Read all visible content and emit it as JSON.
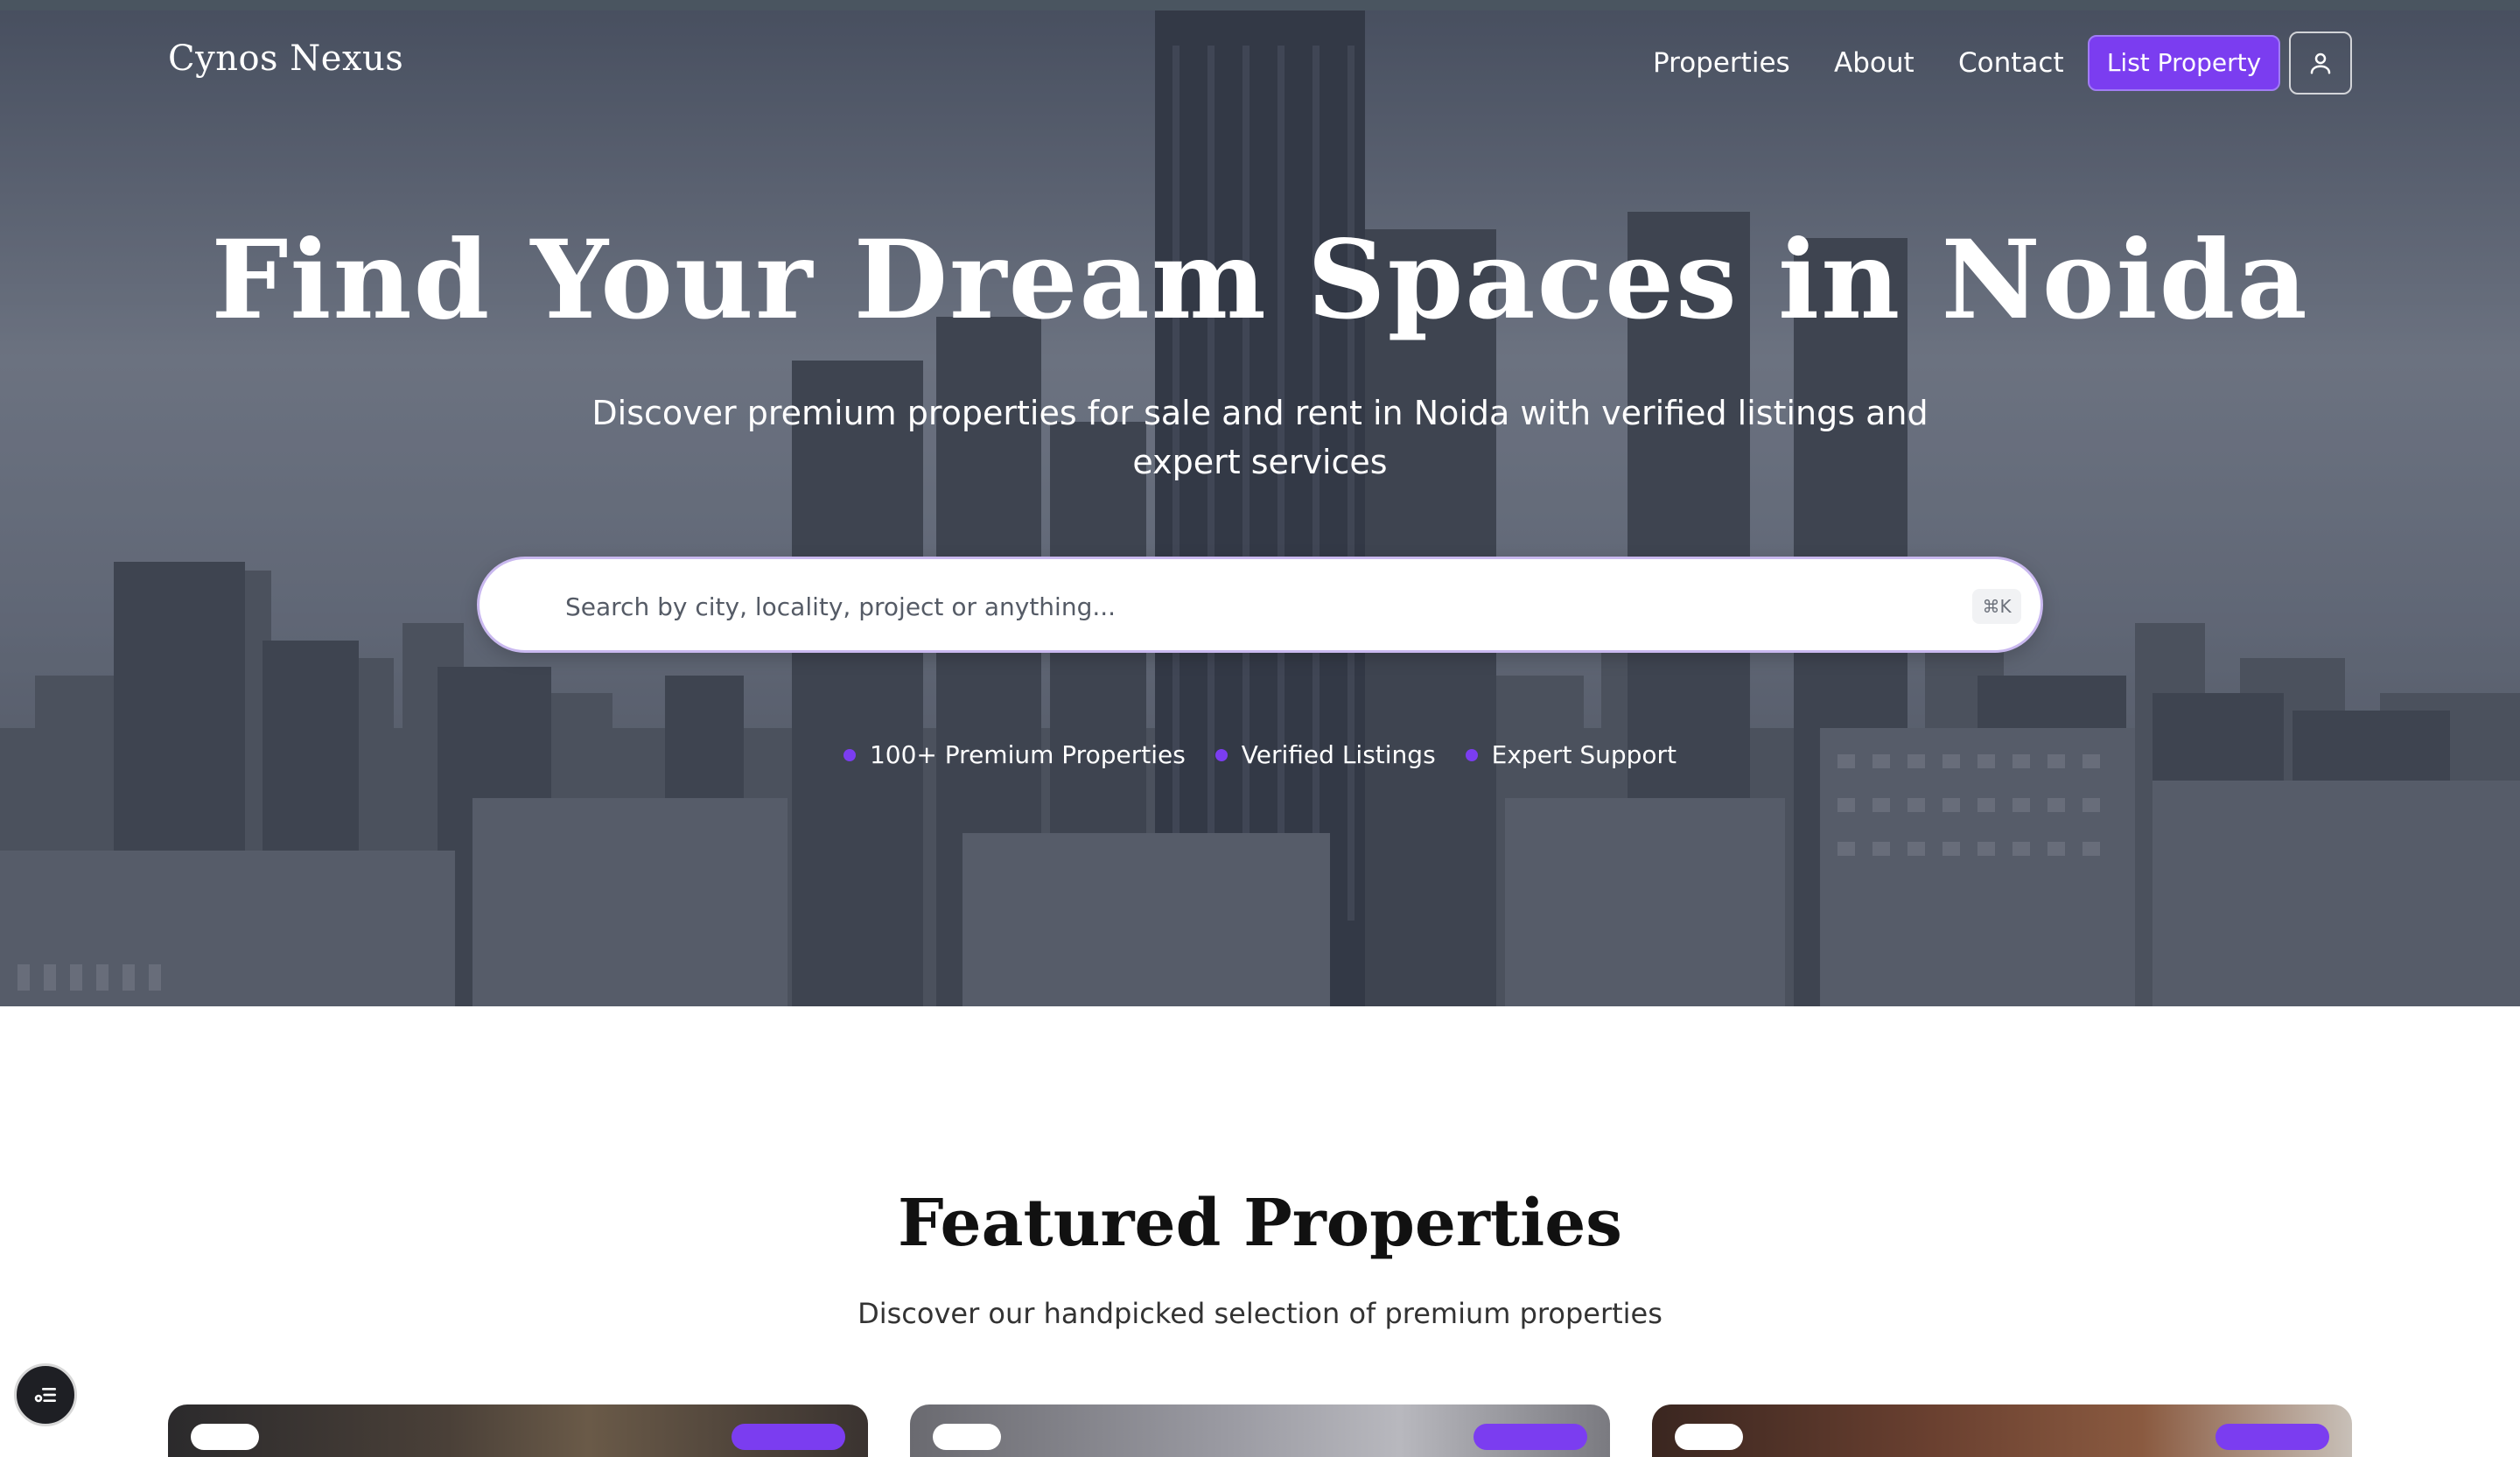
{
  "brand": {
    "logo_text": "Cynos Nexus"
  },
  "nav": {
    "links": [
      "Properties",
      "About",
      "Contact"
    ],
    "cta_label": "List Property",
    "user_icon": "user-icon"
  },
  "hero": {
    "title": "Find Your Dream Spaces in Noida",
    "subtitle": "Discover premium properties for sale and rent in Noida with verified listings and expert services",
    "search": {
      "placeholder": "Search by city, locality, project or anything...",
      "value": "",
      "shortcut": "⌘K"
    },
    "features": [
      "100+ Premium Properties",
      "Verified Listings",
      "Expert Support"
    ]
  },
  "featured": {
    "title": "Featured Properties",
    "subtitle": "Discover our handpicked selection of premium properties"
  },
  "colors": {
    "accent": "#7b3df0",
    "hero_overlay": "#1c2230",
    "text_dark": "#111111"
  },
  "floating_button_icon": "menu-list-icon"
}
